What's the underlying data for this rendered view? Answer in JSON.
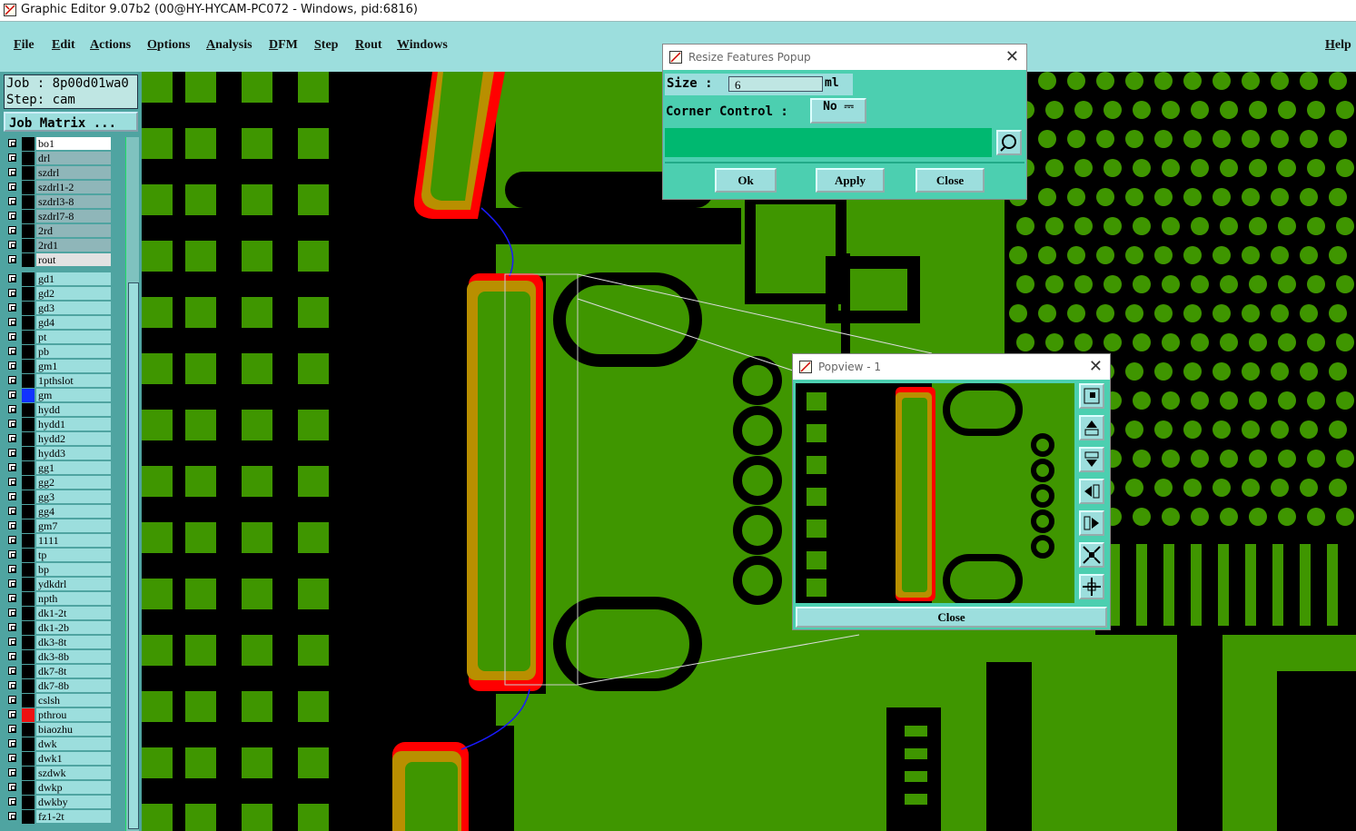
{
  "window": {
    "title": "Graphic Editor 9.07b2 (00@HY-HYCAM-PC072 - Windows, pid:6816)"
  },
  "menu": {
    "items": [
      "File",
      "Edit",
      "Actions",
      "Options",
      "Analysis",
      "DFM",
      "Step",
      "Rout",
      "Windows"
    ],
    "help": "Help"
  },
  "job": {
    "job_line": "Job : 8p00d01wa0",
    "step_line": "Step: cam",
    "matrix_button": "Job Matrix ..."
  },
  "layers": [
    {
      "name": "bo1",
      "bg": "#ffffff",
      "swatch": "#000000"
    },
    {
      "name": "drl",
      "bg": "#8fb6b9",
      "swatch": "#000000"
    },
    {
      "name": "szdrl",
      "bg": "#8fb6b9",
      "swatch": "#000000"
    },
    {
      "name": "szdrl1-2",
      "bg": "#8fb6b9",
      "swatch": "#000000"
    },
    {
      "name": "szdrl3-8",
      "bg": "#8fb6b9",
      "swatch": "#000000"
    },
    {
      "name": "szdrl7-8",
      "bg": "#8fb6b9",
      "swatch": "#000000"
    },
    {
      "name": "2rd",
      "bg": "#8fb6b9",
      "swatch": "#000000"
    },
    {
      "name": "2rd1",
      "bg": "#8fb6b9",
      "swatch": "#000000"
    },
    {
      "name": "rout",
      "bg": "#e2e2e2",
      "swatch": "#000000"
    },
    {
      "name": "gd1",
      "bg": "#9cdedd",
      "swatch": "#000000"
    },
    {
      "name": "gd2",
      "bg": "#9cdedd",
      "swatch": "#000000"
    },
    {
      "name": "gd3",
      "bg": "#9cdedd",
      "swatch": "#000000"
    },
    {
      "name": "gd4",
      "bg": "#9cdedd",
      "swatch": "#000000"
    },
    {
      "name": "pt",
      "bg": "#9cdedd",
      "swatch": "#000000"
    },
    {
      "name": "pb",
      "bg": "#9cdedd",
      "swatch": "#000000"
    },
    {
      "name": "gm1",
      "bg": "#9cdedd",
      "swatch": "#000000"
    },
    {
      "name": "1pthslot",
      "bg": "#9cdedd",
      "swatch": "#000000"
    },
    {
      "name": "gm",
      "bg": "#9cdedd",
      "swatch": "#1133ff"
    },
    {
      "name": "hydd",
      "bg": "#9cdedd",
      "swatch": "#000000"
    },
    {
      "name": "hydd1",
      "bg": "#9cdedd",
      "swatch": "#000000"
    },
    {
      "name": "hydd2",
      "bg": "#9cdedd",
      "swatch": "#000000"
    },
    {
      "name": "hydd3",
      "bg": "#9cdedd",
      "swatch": "#000000"
    },
    {
      "name": "gg1",
      "bg": "#9cdedd",
      "swatch": "#000000"
    },
    {
      "name": "gg2",
      "bg": "#9cdedd",
      "swatch": "#000000"
    },
    {
      "name": "gg3",
      "bg": "#9cdedd",
      "swatch": "#000000"
    },
    {
      "name": "gg4",
      "bg": "#9cdedd",
      "swatch": "#000000"
    },
    {
      "name": "gm7",
      "bg": "#9cdedd",
      "swatch": "#000000"
    },
    {
      "name": "1111",
      "bg": "#9cdedd",
      "swatch": "#000000"
    },
    {
      "name": "tp",
      "bg": "#9cdedd",
      "swatch": "#000000"
    },
    {
      "name": "bp",
      "bg": "#9cdedd",
      "swatch": "#000000"
    },
    {
      "name": "ydkdrl",
      "bg": "#9cdedd",
      "swatch": "#000000"
    },
    {
      "name": "npth",
      "bg": "#9cdedd",
      "swatch": "#000000"
    },
    {
      "name": "dk1-2t",
      "bg": "#9cdedd",
      "swatch": "#000000"
    },
    {
      "name": "dk1-2b",
      "bg": "#9cdedd",
      "swatch": "#000000"
    },
    {
      "name": "dk3-8t",
      "bg": "#9cdedd",
      "swatch": "#000000"
    },
    {
      "name": "dk3-8b",
      "bg": "#9cdedd",
      "swatch": "#000000"
    },
    {
      "name": "dk7-8t",
      "bg": "#9cdedd",
      "swatch": "#000000"
    },
    {
      "name": "dk7-8b",
      "bg": "#9cdedd",
      "swatch": "#000000"
    },
    {
      "name": "cslsh",
      "bg": "#9cdedd",
      "swatch": "#000000"
    },
    {
      "name": "pthrou",
      "bg": "#9cdedd",
      "swatch": "#ee1111"
    },
    {
      "name": "biaozhu",
      "bg": "#9cdedd",
      "swatch": "#000000"
    },
    {
      "name": "dwk",
      "bg": "#9cdedd",
      "swatch": "#000000"
    },
    {
      "name": "dwk1",
      "bg": "#9cdedd",
      "swatch": "#000000"
    },
    {
      "name": "szdwk",
      "bg": "#9cdedd",
      "swatch": "#000000"
    },
    {
      "name": "dwkp",
      "bg": "#9cdedd",
      "swatch": "#000000"
    },
    {
      "name": "dwkby",
      "bg": "#9cdedd",
      "swatch": "#000000"
    },
    {
      "name": "fz1-2t",
      "bg": "#9cdedd",
      "swatch": "#000000"
    }
  ],
  "resize": {
    "title": "Resize Features Popup",
    "size_label": "Size :",
    "size_value": "6",
    "unit": "ml",
    "corner_label": "Corner Control :",
    "corner_value": "No",
    "ok": "Ok",
    "apply": "Apply",
    "close": "Close"
  },
  "popview": {
    "title": "Popview - 1",
    "close": "Close"
  },
  "colors": {
    "board": "#3f9600",
    "copper_feature": "#b98f00",
    "highlight": "#ff0000",
    "panel": "#9cdedd"
  }
}
